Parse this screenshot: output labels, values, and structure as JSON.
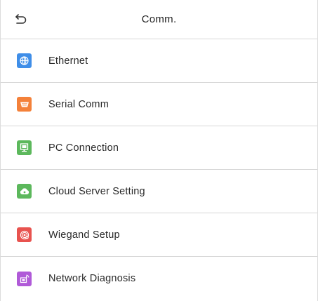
{
  "header": {
    "title": "Comm.",
    "back_icon": "return-arrow-icon"
  },
  "menu": {
    "items": [
      {
        "label": "Ethernet",
        "icon": "globe-icon",
        "color": "#3f8ee8"
      },
      {
        "label": "Serial Comm",
        "icon": "serial-port-icon",
        "color": "#f4813a"
      },
      {
        "label": "PC Connection",
        "icon": "pc-monitor-icon",
        "color": "#5cb85c"
      },
      {
        "label": "Cloud Server Setting",
        "icon": "cloud-icon",
        "color": "#5cb85c"
      },
      {
        "label": "Wiegand Setup",
        "icon": "wiegand-icon",
        "color": "#e8534f"
      },
      {
        "label": "Network Diagnosis",
        "icon": "network-diagnosis-icon",
        "color": "#b05ad8"
      }
    ]
  }
}
